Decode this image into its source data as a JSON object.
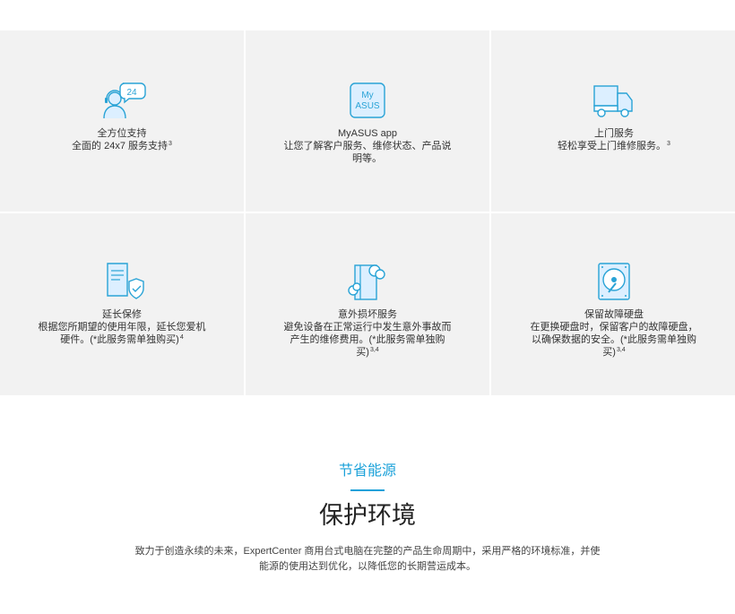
{
  "features": [
    {
      "icon": "support-headset-icon",
      "title": "全方位支持",
      "desc": "全面的 24x7 服务支持",
      "sup": "3",
      "badge": "24"
    },
    {
      "icon": "myasus-app-icon",
      "title": "MyASUS app",
      "desc": "让您了解客户服务、维修状态、产品说明等。",
      "sup": "",
      "badge_line1": "My",
      "badge_line2": "ASUS"
    },
    {
      "icon": "delivery-truck-icon",
      "title": "上门服务",
      "desc": "轻松享受上门维修服务。",
      "sup": "3"
    },
    {
      "icon": "warranty-document-icon",
      "title": "延长保修",
      "desc": "根据您所期望的使用年限，延长您爱机硬件。(*此服务需单独购买)",
      "sup": "4"
    },
    {
      "icon": "accidental-damage-icon",
      "title": "意外损坏服务",
      "desc": "避免设备在正常运行中发生意外事故而产生的维修费用。(*此服务需单独购买)",
      "sup": "3,4"
    },
    {
      "icon": "hard-drive-icon",
      "title": "保留故障硬盘",
      "desc": "在更换硬盘时，保留客户的故障硬盘，以确保数据的安全。(*此服务需单独购买)",
      "sup": "3,4"
    }
  ],
  "eco": {
    "kicker": "节省能源",
    "heading": "保护环境",
    "body": "致力于创造永续的未来，ExpertCenter 商用台式电脑在完整的产品生命周期中，采用严格的环境标准，并使能源的使用达到优化，以降低您的长期营运成本。"
  },
  "colors": {
    "accent": "#1aa1d9",
    "card_bg": "#f2f2f2",
    "icon_fill": "#dcefff"
  }
}
